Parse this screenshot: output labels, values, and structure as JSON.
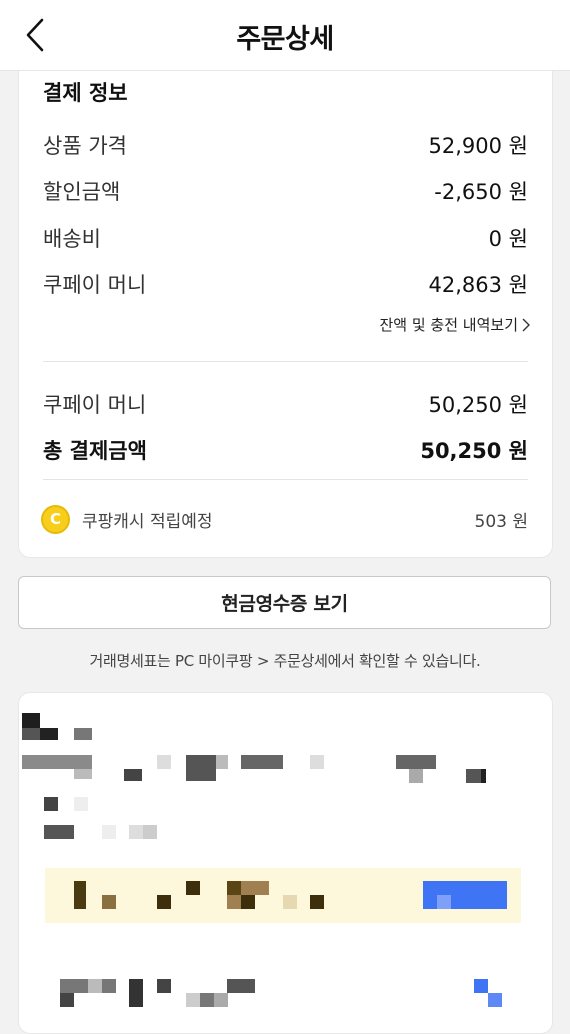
{
  "header": {
    "title": "주문상세",
    "back_icon": "chevron-left-icon"
  },
  "payment": {
    "section_title": "결제 정보",
    "rows": [
      {
        "label": "상품 가격",
        "value": "52,900 원"
      },
      {
        "label": "할인금액",
        "value": "-2,650 원"
      },
      {
        "label": "배송비",
        "value": "0 원"
      },
      {
        "label": "쿠페이 머니",
        "value": "42,863 원"
      }
    ],
    "history_link": "잔액 및 충전 내역보기",
    "summary": [
      {
        "label": "쿠페이 머니",
        "value": "50,250 원"
      },
      {
        "label": "총 결제금액",
        "value": "50,250 원"
      }
    ],
    "cash": {
      "coin_letter": "C",
      "label": "쿠팡캐시 적립예정",
      "value": "503 원"
    }
  },
  "receipt_button": "현금영수증 보기",
  "note": "거래명세표는 PC 마이쿠팡 > 주문상세에서 확인할 수 있습니다.",
  "colors": {
    "coin": "#f7cf1a",
    "band": "#fdf8dc",
    "accent_blue": "#3f74f5"
  }
}
